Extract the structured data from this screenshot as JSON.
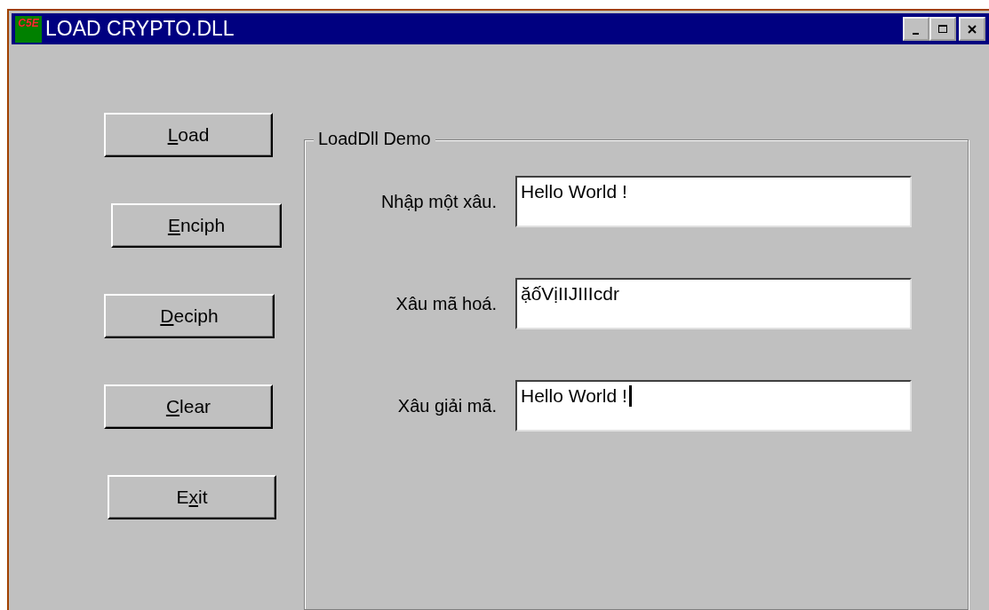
{
  "window": {
    "title": "LOAD CRYPTO.DLL",
    "icon_text": "C5E"
  },
  "buttons": [
    {
      "key": "L",
      "after": "oad"
    },
    {
      "key": "E",
      "after": "nciph"
    },
    {
      "key": "D",
      "after": "eciph"
    },
    {
      "key": "C",
      "after": "lear"
    },
    {
      "before": "E",
      "key": "x",
      "after": "it"
    }
  ],
  "group": {
    "title": "LoadDll Demo",
    "fields": [
      {
        "label": "Nhập một xâu.",
        "value": "Hello World !",
        "focused": false
      },
      {
        "label": "Xâu mã hoá.",
        "value": "ặốVịIIJIIIcdr",
        "focused": false
      },
      {
        "label": "Xâu giải mã.",
        "value": "Hello World !",
        "focused": true
      }
    ]
  }
}
